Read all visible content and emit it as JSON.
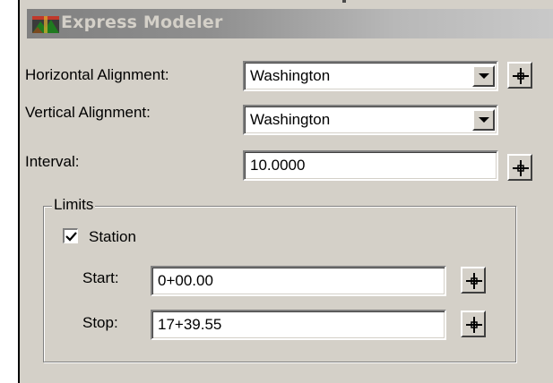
{
  "window": {
    "title": "Express Modeler",
    "icon": "express-modeler-app-icon"
  },
  "form": {
    "horizontal_alignment": {
      "label": "Horizontal Alignment:",
      "value": "Washington",
      "pick_icon": "crosshair-icon"
    },
    "vertical_alignment": {
      "label": "Vertical Alignment:",
      "value": "Washington"
    },
    "interval": {
      "label": "Interval:",
      "value": "10.0000",
      "pick_icon": "crosshair-icon"
    }
  },
  "limits": {
    "group_label": "Limits",
    "station": {
      "label": "Station",
      "checked": true
    },
    "start": {
      "label": "Start:",
      "value": "0+00.00",
      "pick_icon": "crosshair-icon"
    },
    "stop": {
      "label": "Stop:",
      "value": "17+39.55",
      "pick_icon": "crosshair-icon"
    }
  }
}
